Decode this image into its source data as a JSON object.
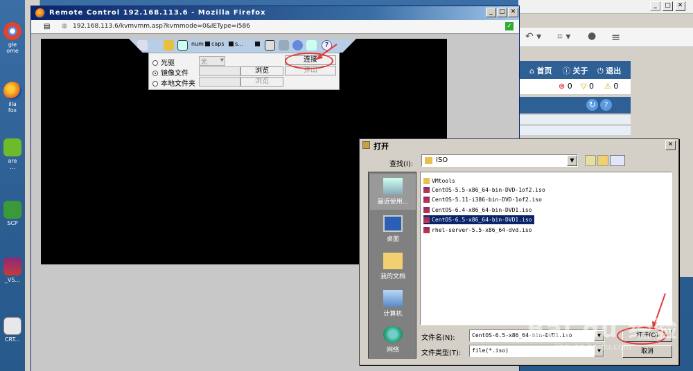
{
  "desktop": {
    "icons": [
      {
        "label": "gle\nome"
      },
      {
        "label": "illa\nfox"
      },
      {
        "label": "are\n..."
      },
      {
        "label": "SCP"
      },
      {
        "label": "_VS..."
      },
      {
        "label": "CRT..."
      }
    ]
  },
  "browser_window": {
    "title": "Remote Control 192.168.113.6 - Mozilla Firefox",
    "url": "192.168.113.6/kvmvmm.asp?kvmmode=0&IEType=i586",
    "win_min": "_",
    "win_max": "□",
    "win_close": "✕"
  },
  "bg_window": {
    "nav": {
      "home": "首页",
      "about": "关于",
      "logout": "退出"
    },
    "status": {
      "errors": "0",
      "warnings": "0",
      "alerts": "0"
    }
  },
  "kvm_toolbar": {
    "num": "num",
    "caps": "caps",
    "scroll": "s..."
  },
  "media_panel": {
    "optical": "光驱",
    "optical_value": "无",
    "image_file": "镜像文件",
    "local_folder": "本地文件夹",
    "browse1": "浏览",
    "browse2": "浏览",
    "connect": "连接",
    "eject": "弹出"
  },
  "open_dialog": {
    "title": "打开",
    "lookin_label": "查找(I):",
    "lookin_value": "ISO",
    "places": [
      {
        "label": "最近使用..."
      },
      {
        "label": "桌面"
      },
      {
        "label": "我的文档"
      },
      {
        "label": "计算机"
      },
      {
        "label": "网络"
      }
    ],
    "files": [
      {
        "name": "VMtools",
        "type": "folder"
      },
      {
        "name": "CentOS-5.5-x86_64-bin-DVD-1of2.iso",
        "type": "iso"
      },
      {
        "name": "CentOS-5.11-i386-bin-DVD-1of2.iso",
        "type": "iso"
      },
      {
        "name": "CentOS-6.4-x86_64-bin-DVD1.iso",
        "type": "iso"
      },
      {
        "name": "CentOS-6.5-x86_64-bin-DVD1.iso",
        "type": "iso",
        "selected": true
      },
      {
        "name": "rhel-server-5.5-x86_64-dvd.iso",
        "type": "iso"
      }
    ],
    "filename_label": "文件名(N):",
    "filename_value": "CentOS-6.5-x86_64-bin-DVD1.iso",
    "filetype_label": "文件类型(T):",
    "filetype_value": "file(*.iso)",
    "open_button": "打开(O)",
    "cancel_button": "取消",
    "close": "✕"
  },
  "watermark": {
    "main": "Bai du 经验",
    "sub": "jingyan.baidu.com"
  }
}
